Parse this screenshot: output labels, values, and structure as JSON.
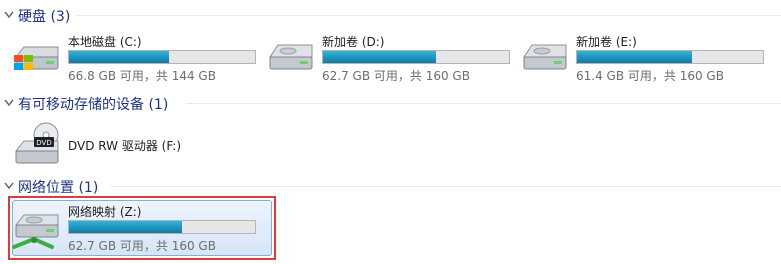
{
  "groups": [
    {
      "title": "硬盘 (3)",
      "items": [
        {
          "name": "本地磁盘 (C:)",
          "free": "66.8 GB 可用，共 144 GB",
          "used_fraction": 0.54
        },
        {
          "name": "新加卷 (D:)",
          "free": "62.7 GB 可用，共 160 GB",
          "used_fraction": 0.61
        },
        {
          "name": "新加卷 (E:)",
          "free": "61.4 GB 可用，共 160 GB",
          "used_fraction": 0.62
        }
      ]
    },
    {
      "title": "有可移动存储的设备 (1)",
      "items": [
        {
          "name": "DVD RW 驱动器 (F:)",
          "icon_label": "DVD"
        }
      ]
    },
    {
      "title": "网络位置 (1)",
      "items": [
        {
          "name": "网络映射 (Z:)",
          "free": "62.7 GB 可用，共 160 GB",
          "used_fraction": 0.61,
          "selected": true
        }
      ]
    }
  ],
  "colors": {
    "header_text": "#1e3287",
    "bar_fill": "#1f9ac5",
    "selection_outline": "#e03b3b"
  }
}
